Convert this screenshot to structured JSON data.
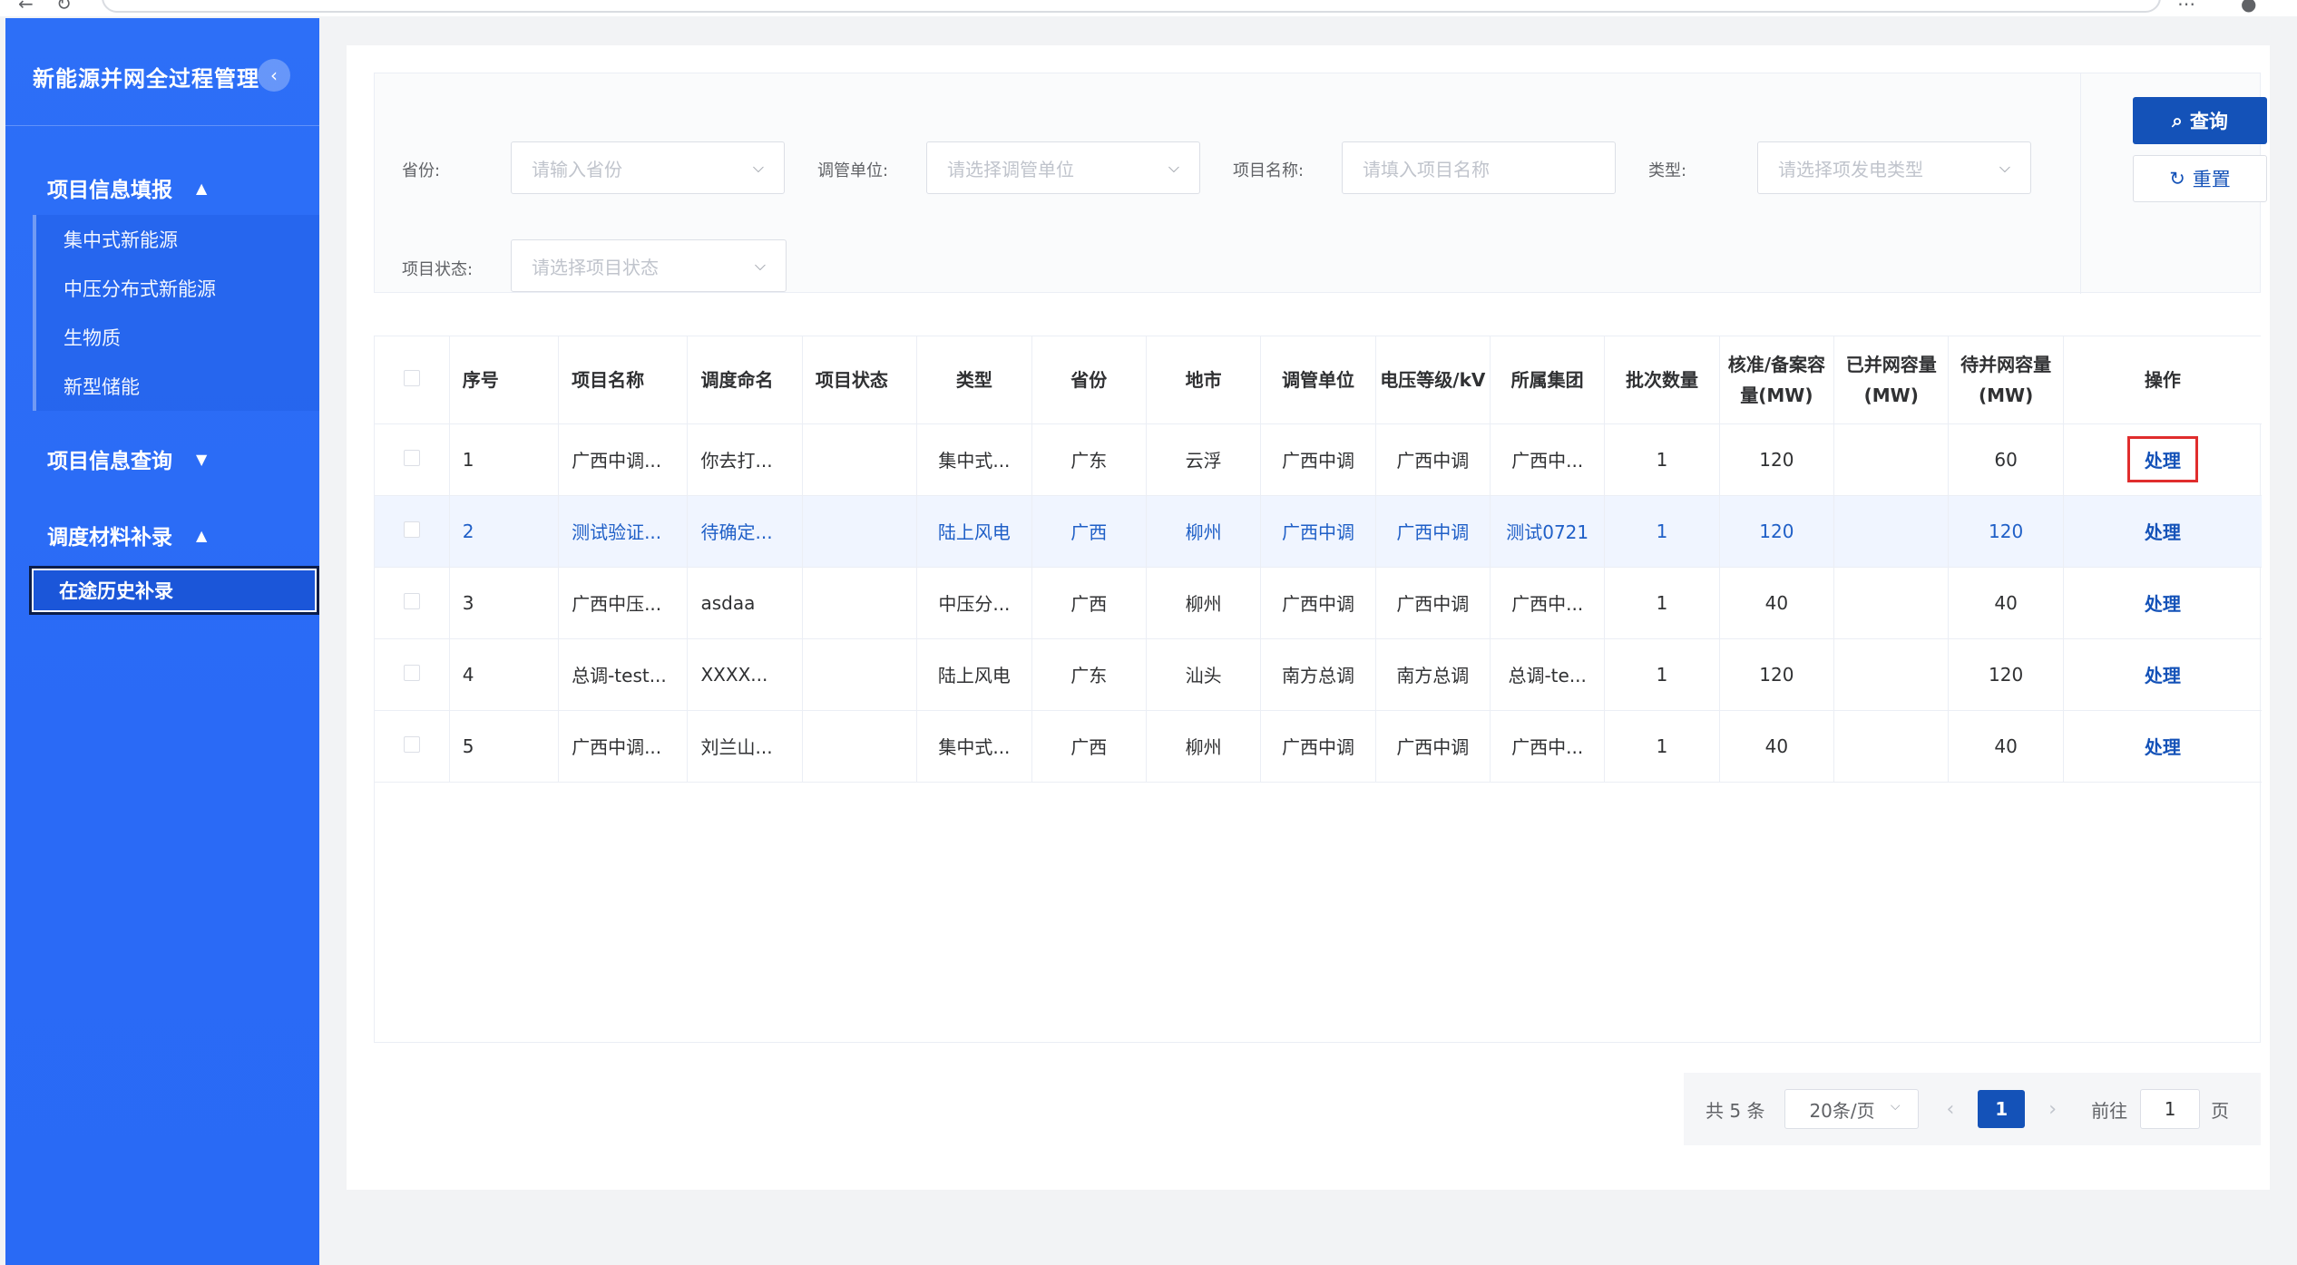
{
  "sidebar": {
    "brand": "新能源并网全过程管理",
    "collapse_icon": "‹",
    "groups": [
      {
        "title": "项目信息填报",
        "arrow": "▲",
        "items": [
          "集中式新能源",
          "中压分布式新能源",
          "生物质",
          "新型储能"
        ]
      },
      {
        "title": "项目信息查询",
        "arrow": "▼",
        "items": []
      },
      {
        "title": "调度材料补录",
        "arrow": "▲",
        "items": [
          "在途历史补录"
        ]
      }
    ]
  },
  "filters": {
    "province": {
      "label": "省份:",
      "placeholder": "请输入省份"
    },
    "dispatch_unit": {
      "label": "调管单位:",
      "placeholder": "请选择调管单位"
    },
    "project_name": {
      "label": "项目名称:",
      "placeholder": "请填入项目名称"
    },
    "type": {
      "label": "类型:",
      "placeholder": "请选择项发电类型"
    },
    "status": {
      "label": "项目状态:",
      "placeholder": "请选择项目状态"
    }
  },
  "buttons": {
    "query": "查询",
    "reset": "重置"
  },
  "table": {
    "headers": [
      "序号",
      "项目名称",
      "调度命名",
      "项目状态",
      "类型",
      "省份",
      "地市",
      "调管单位",
      "电压等级/kV",
      "所属集团",
      "批次数量",
      "核准/备案容量(MW)",
      "已并网容量(MW)",
      "待并网容量(MW)",
      "操作"
    ],
    "rows": [
      {
        "no": "1",
        "name": "广西中调...",
        "dispatch_name": "你去打...",
        "status": "",
        "type": "集中式...",
        "province": "广东",
        "city": "云浮",
        "unit": "广西中调",
        "voltage": "广西中调",
        "group": "广西中...",
        "batch": "1",
        "approved": "120",
        "connected": "",
        "pending": "60",
        "action": "处理"
      },
      {
        "no": "2",
        "name": "测试验证...",
        "dispatch_name": "待确定...",
        "status": "",
        "type": "陆上风电",
        "province": "广西",
        "city": "柳州",
        "unit": "广西中调",
        "voltage": "广西中调",
        "group": "测试0721",
        "batch": "1",
        "approved": "120",
        "connected": "",
        "pending": "120",
        "action": "处理"
      },
      {
        "no": "3",
        "name": "广西中压...",
        "dispatch_name": "asdaa",
        "status": "",
        "type": "中压分...",
        "province": "广西",
        "city": "柳州",
        "unit": "广西中调",
        "voltage": "广西中调",
        "group": "广西中...",
        "batch": "1",
        "approved": "40",
        "connected": "",
        "pending": "40",
        "action": "处理"
      },
      {
        "no": "4",
        "name": "总调-test...",
        "dispatch_name": "XXXX...",
        "status": "",
        "type": "陆上风电",
        "province": "广东",
        "city": "汕头",
        "unit": "南方总调",
        "voltage": "南方总调",
        "group": "总调-te...",
        "batch": "1",
        "approved": "120",
        "connected": "",
        "pending": "120",
        "action": "处理"
      },
      {
        "no": "5",
        "name": "广西中调...",
        "dispatch_name": "刘兰山...",
        "status": "",
        "type": "集中式...",
        "province": "广西",
        "city": "柳州",
        "unit": "广西中调",
        "voltage": "广西中调",
        "group": "广西中...",
        "batch": "1",
        "approved": "40",
        "connected": "",
        "pending": "40",
        "action": "处理"
      }
    ]
  },
  "pagination": {
    "total": "共 5 条",
    "page_size": "20条/页",
    "current": "1",
    "goto_label": "前往",
    "goto_value": "1",
    "goto_unit": "页"
  }
}
